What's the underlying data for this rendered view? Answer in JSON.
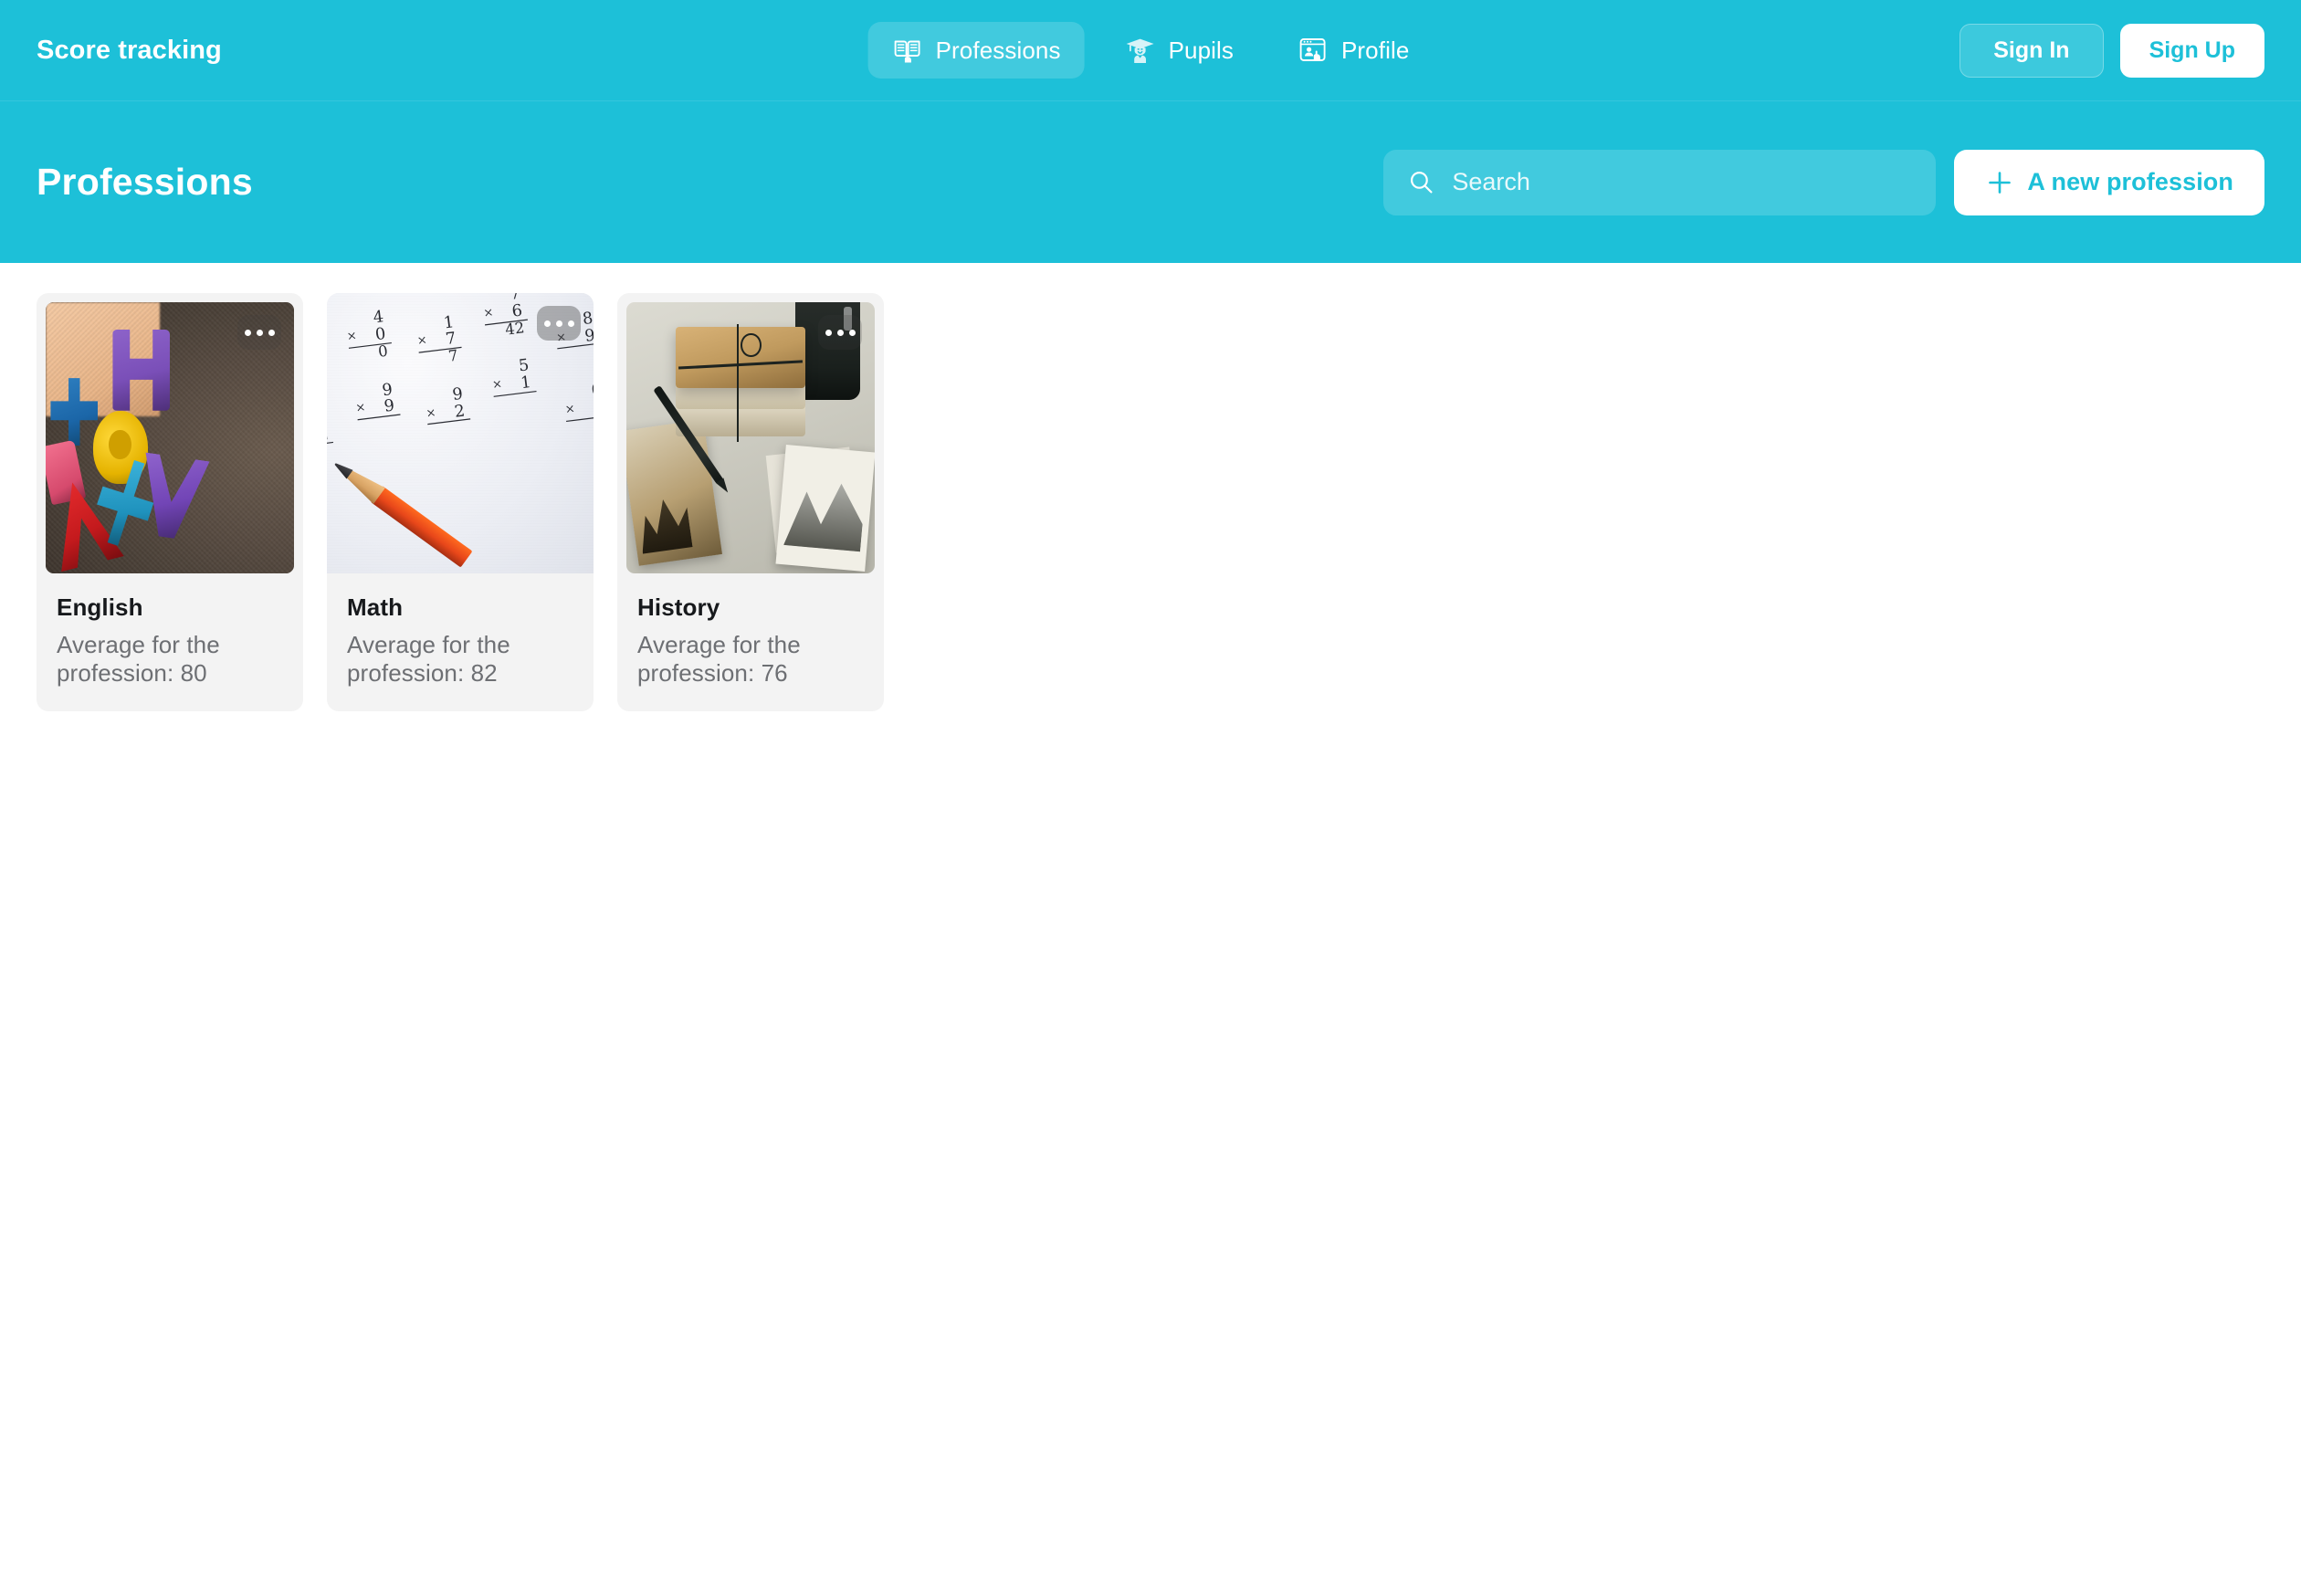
{
  "brand": "Score tracking",
  "colors": {
    "accent": "#1dc0d8",
    "card_bg": "#f3f3f3",
    "title_text": "#17191c",
    "sub_text": "#6d6f73",
    "on_accent": "#ffffff"
  },
  "nav": {
    "items": [
      {
        "label": "Professions",
        "icon": "book-open-icon",
        "active": true
      },
      {
        "label": "Pupils",
        "icon": "graduate-icon",
        "active": false
      },
      {
        "label": "Profile",
        "icon": "profile-card-icon",
        "active": false
      }
    ]
  },
  "auth": {
    "sign_in_label": "Sign In",
    "sign_up_label": "Sign Up"
  },
  "subheader": {
    "title": "Professions",
    "search_placeholder": "Search",
    "search_value": "",
    "search_icon": "search-icon",
    "new_button_label": "A new profession",
    "new_button_icon": "plus-icon"
  },
  "cards": [
    {
      "title": "English",
      "subtitle": "Average for the profession: 80",
      "average": 80,
      "menu_icon": "more-horizontal-icon",
      "thumbnail": "foam-letters-on-fabric"
    },
    {
      "title": "Math",
      "subtitle": "Average for the profession: 82",
      "average": 82,
      "menu_icon": "more-horizontal-icon",
      "thumbnail": "multiplication-worksheet-with-pencil"
    },
    {
      "title": "History",
      "subtitle": "Average for the profession: 76",
      "average": 76,
      "menu_icon": "more-horizontal-icon",
      "thumbnail": "old-books-pen-and-photos"
    }
  ]
}
